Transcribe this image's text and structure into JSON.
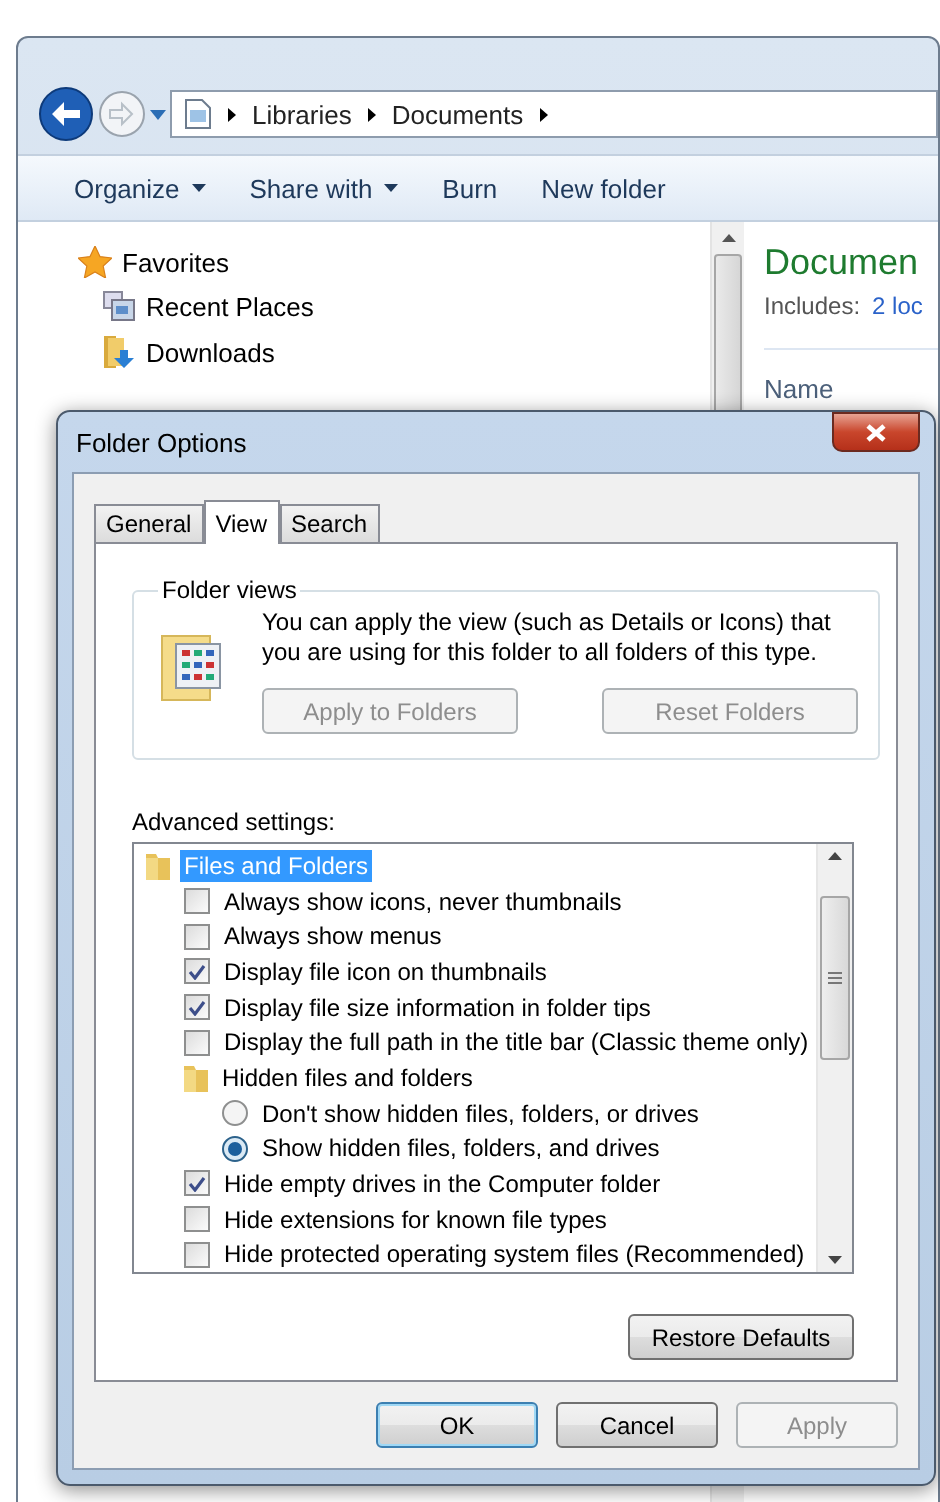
{
  "explorer": {
    "breadcrumb": [
      "Libraries",
      "Documents"
    ],
    "toolbar": [
      {
        "label": "Organize",
        "dropdown": true
      },
      {
        "label": "Share with",
        "dropdown": true
      },
      {
        "label": "Burn",
        "dropdown": false
      },
      {
        "label": "New folder",
        "dropdown": false
      }
    ],
    "nav": [
      {
        "kind": "favorites",
        "label": "Favorites"
      },
      {
        "kind": "recent",
        "label": "Recent Places"
      },
      {
        "kind": "downloads",
        "label": "Downloads"
      }
    ],
    "library": {
      "title": "Documen",
      "includes_label": "Includes:",
      "includes_link": "2 loc",
      "column": "Name"
    }
  },
  "dialog": {
    "title": "Folder Options",
    "tabs": [
      {
        "label": "General",
        "selected": false
      },
      {
        "label": "View",
        "selected": true
      },
      {
        "label": "Search",
        "selected": false
      }
    ],
    "folder_views": {
      "legend": "Folder views",
      "text": "You can apply the view (such as Details or Icons) that you are using for this folder to all folders of this type.",
      "buttons": [
        {
          "label": "Apply to Folders",
          "disabled": true
        },
        {
          "label": "Reset Folders",
          "disabled": true
        }
      ]
    },
    "advanced_label": "Advanced settings:",
    "tree": [
      {
        "kind": "folder",
        "label": "Files and Folders",
        "selected": true,
        "children": [
          {
            "kind": "checkbox",
            "label": "Always show icons, never thumbnails",
            "checked": false
          },
          {
            "kind": "checkbox",
            "label": "Always show menus",
            "checked": false
          },
          {
            "kind": "checkbox",
            "label": "Display file icon on thumbnails",
            "checked": true
          },
          {
            "kind": "checkbox",
            "label": "Display file size information in folder tips",
            "checked": true
          },
          {
            "kind": "checkbox",
            "label": "Display the full path in the title bar (Classic theme only)",
            "checked": false
          },
          {
            "kind": "folder",
            "label": "Hidden files and folders",
            "selected": false,
            "children": [
              {
                "kind": "radio",
                "label": "Don't show hidden files, folders, or drives",
                "selected": false
              },
              {
                "kind": "radio",
                "label": "Show hidden files, folders, and drives",
                "selected": true
              }
            ]
          },
          {
            "kind": "checkbox",
            "label": "Hide empty drives in the Computer folder",
            "checked": true
          },
          {
            "kind": "checkbox",
            "label": "Hide extensions for known file types",
            "checked": false
          },
          {
            "kind": "checkbox",
            "label": "Hide protected operating system files (Recommended)",
            "checked": false
          }
        ]
      }
    ],
    "restore": "Restore Defaults",
    "buttons": [
      {
        "label": "OK",
        "default": true,
        "disabled": false
      },
      {
        "label": "Cancel",
        "default": false,
        "disabled": false
      },
      {
        "label": "Apply",
        "default": false,
        "disabled": true
      }
    ]
  }
}
